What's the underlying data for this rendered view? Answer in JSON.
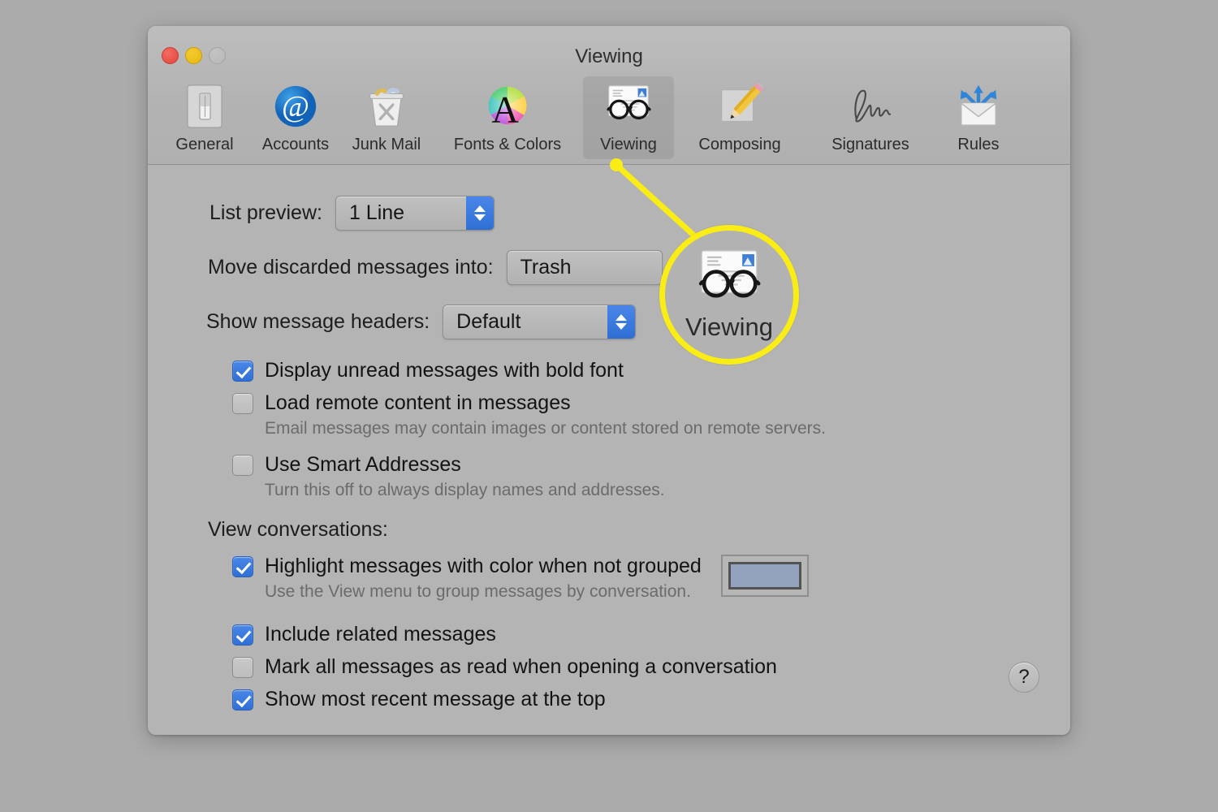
{
  "window": {
    "title": "Viewing",
    "traffic_lights": [
      {
        "name": "close",
        "color": "#e2463c"
      },
      {
        "name": "minimize",
        "color": "#e8b70c"
      },
      {
        "name": "zoom",
        "color": "#bcbcbc"
      }
    ]
  },
  "toolbar": {
    "items": [
      {
        "label": "General",
        "icon": "switch-icon",
        "selected": false
      },
      {
        "label": "Accounts",
        "icon": "at-sign-icon",
        "selected": false
      },
      {
        "label": "Junk Mail",
        "icon": "trash-can-icon",
        "selected": false
      },
      {
        "label": "Fonts & Colors",
        "icon": "color-wheel-a-icon",
        "selected": false
      },
      {
        "label": "Viewing",
        "icon": "eyeglasses-icon",
        "selected": true
      },
      {
        "label": "Composing",
        "icon": "pencil-note-icon",
        "selected": false
      },
      {
        "label": "Signatures",
        "icon": "signature-icon",
        "selected": false
      },
      {
        "label": "Rules",
        "icon": "envelope-arrows-icon",
        "selected": false
      }
    ]
  },
  "settings": {
    "list_preview": {
      "label": "List preview:",
      "value": "1 Line"
    },
    "move_discarded": {
      "label": "Move discarded messages into:",
      "value": "Trash"
    },
    "show_headers": {
      "label": "Show message headers:",
      "value": "Default"
    },
    "checkboxes": [
      {
        "label": "Display unread messages with bold font",
        "checked": true,
        "sub": ""
      },
      {
        "label": "Load remote content in messages",
        "checked": false,
        "sub": "Email messages may contain images or content stored on remote servers."
      },
      {
        "label": "Use Smart Addresses",
        "checked": false,
        "sub": "Turn this off to always display names and addresses."
      }
    ],
    "conversations": {
      "heading": "View conversations:",
      "items": [
        {
          "label": "Highlight messages with color when not grouped",
          "checked": true,
          "sub": "Use the View menu to group messages by conversation.",
          "swatch": "#93a3bd"
        },
        {
          "label": "Include related messages",
          "checked": true,
          "sub": ""
        },
        {
          "label": "Mark all messages as read when opening a conversation",
          "checked": false,
          "sub": ""
        },
        {
          "label": "Show most recent message at the top",
          "checked": true,
          "sub": ""
        }
      ]
    },
    "help_button": "?"
  },
  "callout": {
    "magnified_label": "Viewing",
    "highlight_color": "#faed15"
  }
}
